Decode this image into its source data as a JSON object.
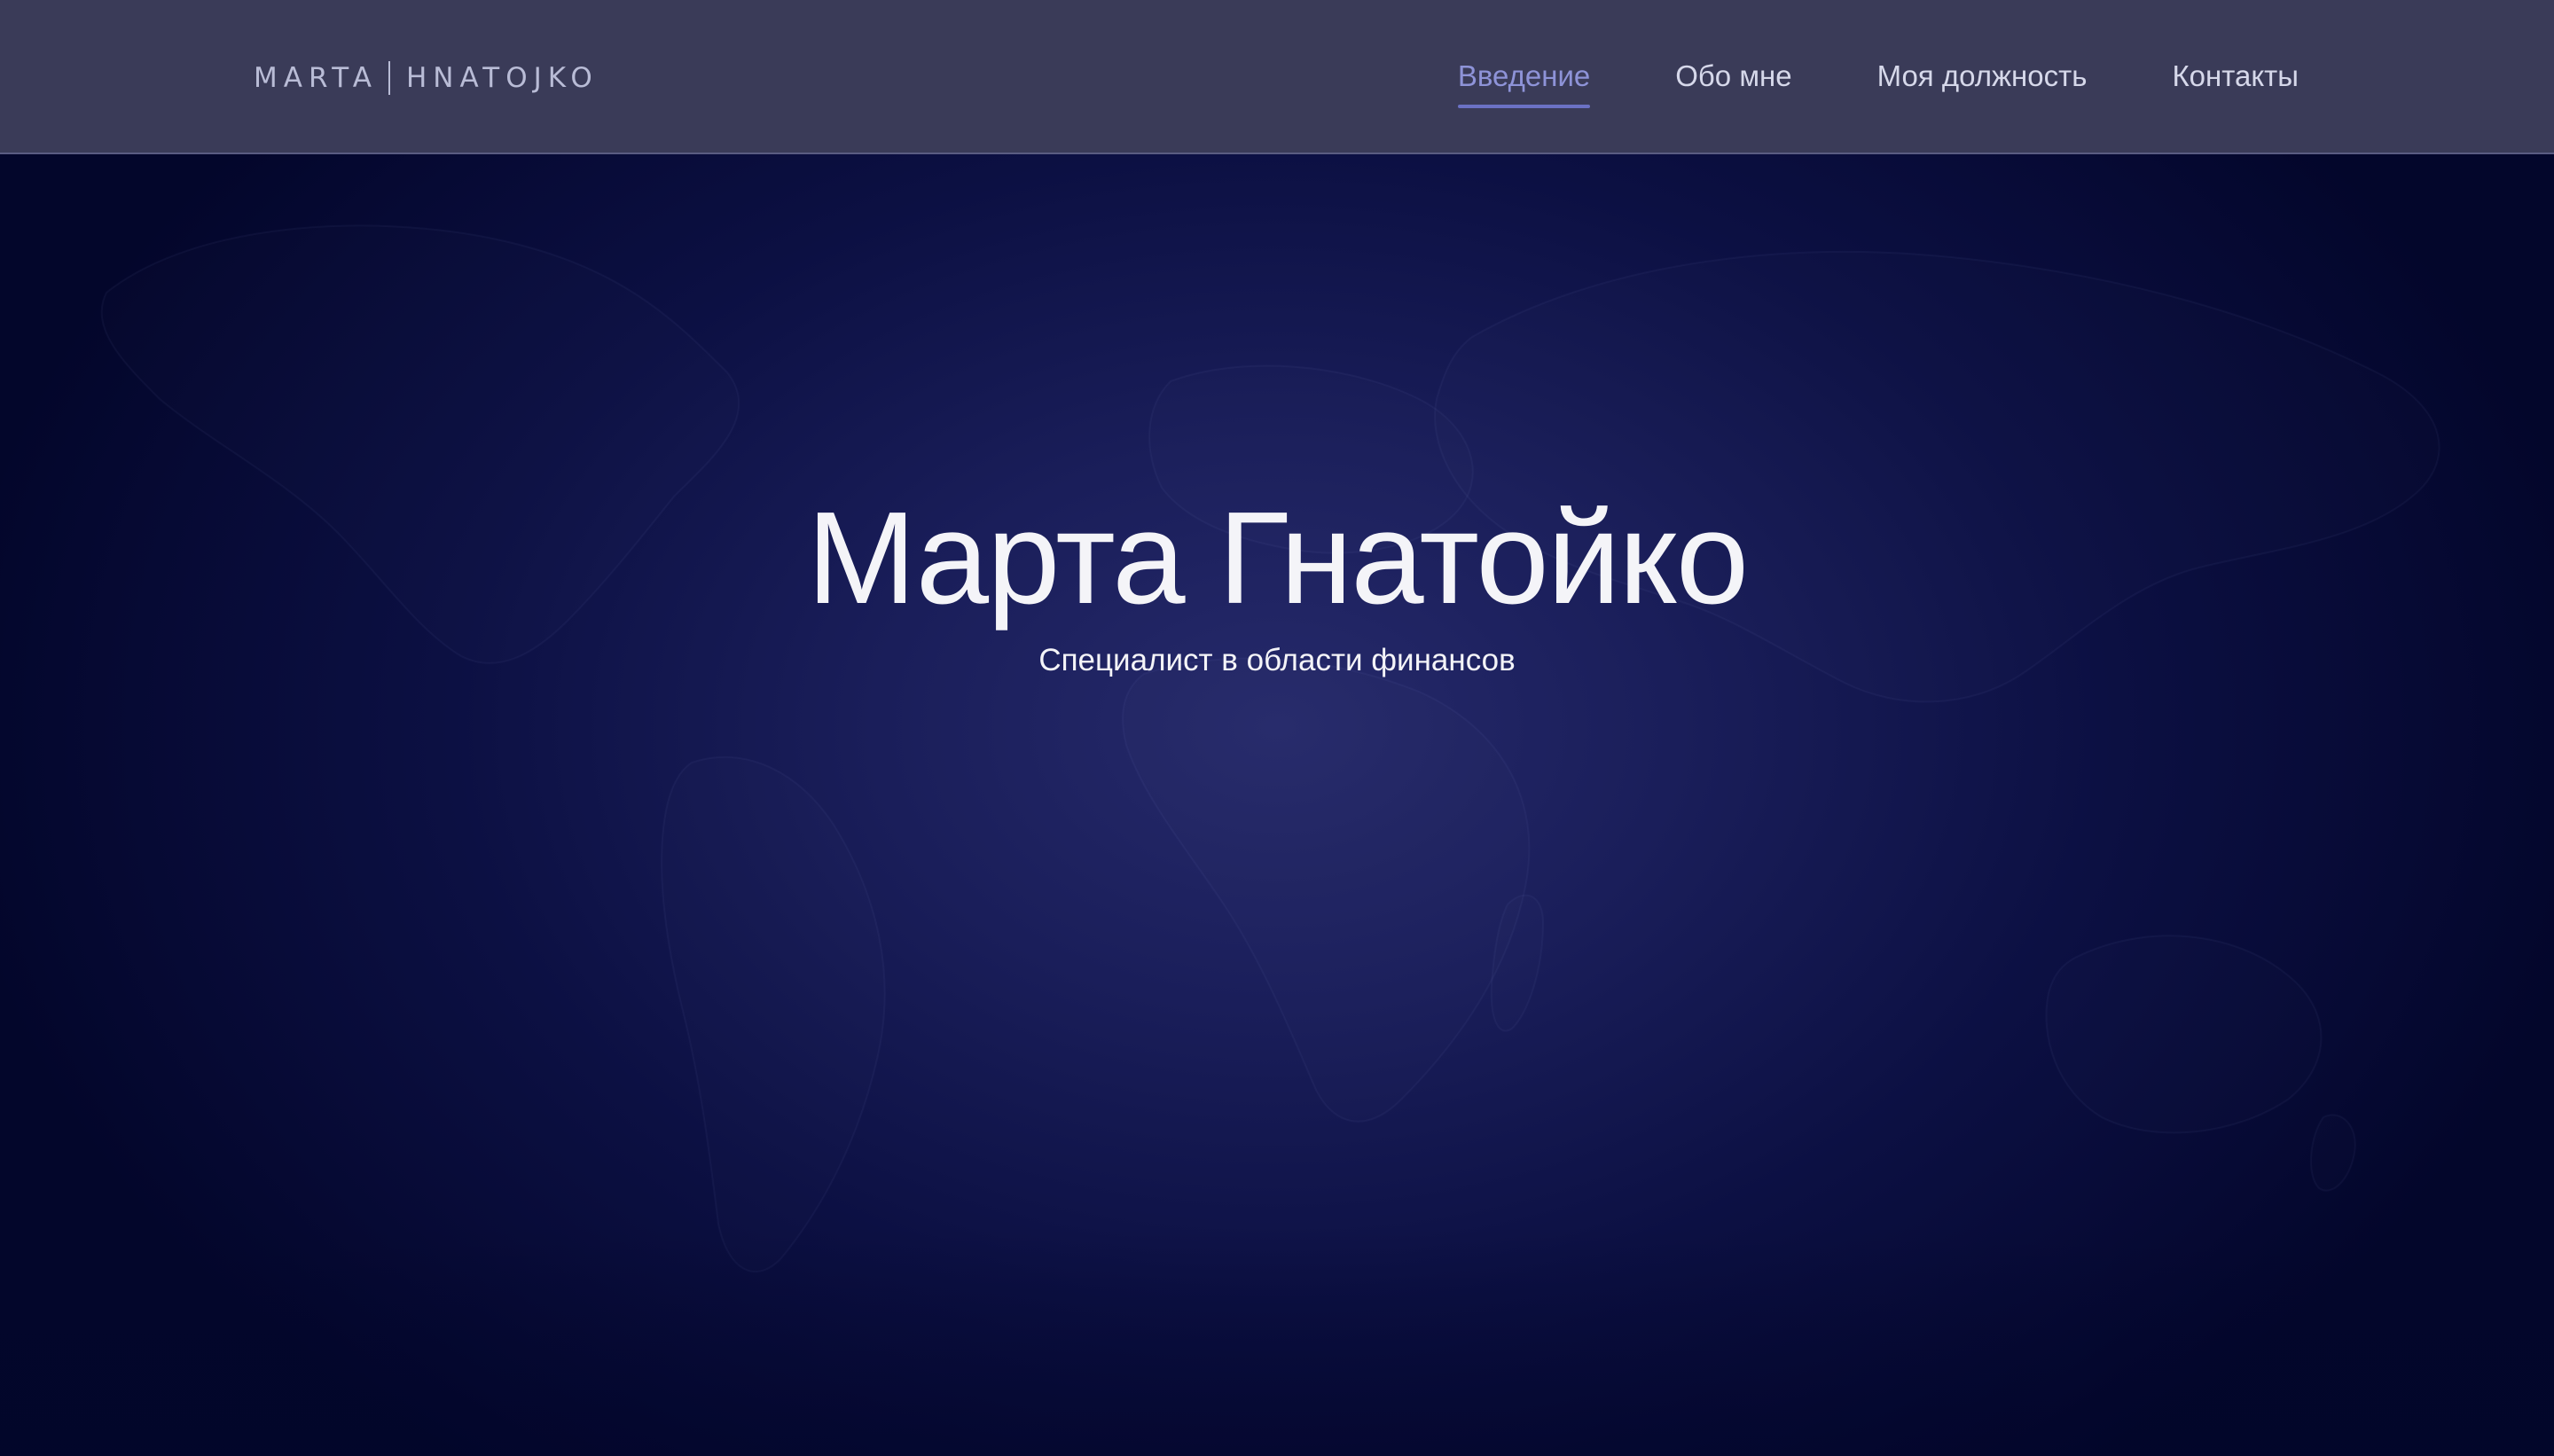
{
  "header": {
    "brand_left": "MARTA",
    "brand_right": "HNATOJKO"
  },
  "nav": {
    "items": [
      {
        "label": "Введение",
        "active": true
      },
      {
        "label": "Обо мне",
        "active": false
      },
      {
        "label": "Моя должность",
        "active": false
      },
      {
        "label": "Контакты",
        "active": false
      }
    ]
  },
  "hero": {
    "title": "Марта Гнатойко",
    "subtitle": "Специалист в области финансов"
  },
  "colors": {
    "header_bg": "#3a3b58",
    "nav_active": "#8e93d8",
    "hero_bg_center": "#262a6b",
    "hero_bg_edge": "#02052a"
  },
  "icons": {
    "background": "world-map-icon"
  }
}
